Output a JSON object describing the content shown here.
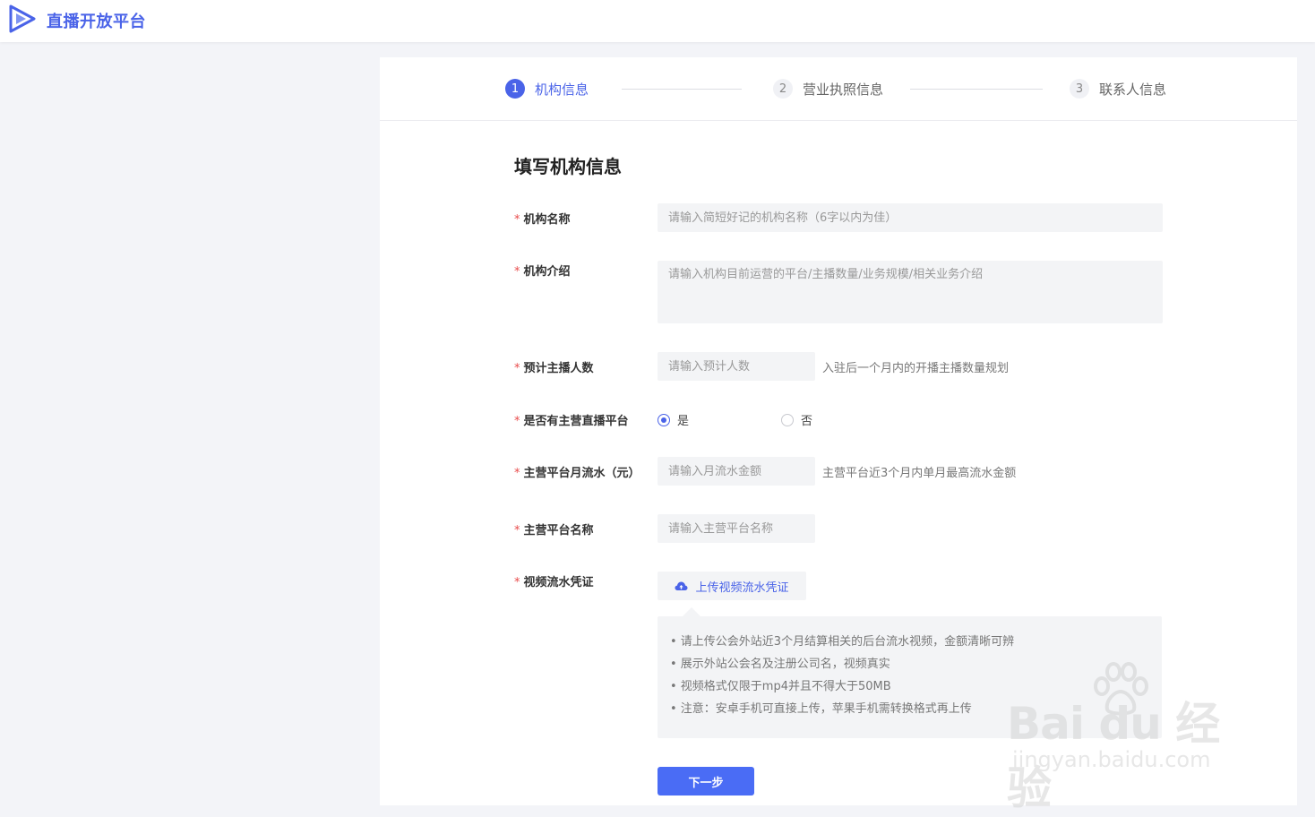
{
  "app": {
    "title": "直播开放平台"
  },
  "steps": [
    {
      "num": "1",
      "label": "机构信息",
      "active": true
    },
    {
      "num": "2",
      "label": "营业执照信息",
      "active": false
    },
    {
      "num": "3",
      "label": "联系人信息",
      "active": false
    }
  ],
  "form": {
    "title": "填写机构信息",
    "required_mark": "*",
    "org_name": {
      "label": "机构名称",
      "placeholder": "请输入简短好记的机构名称（6字以内为佳）",
      "value": ""
    },
    "org_intro": {
      "label": "机构介绍",
      "placeholder": "请输入机构目前运营的平台/主播数量/业务规模/相关业务介绍",
      "value": ""
    },
    "anchor_count": {
      "label": "预计主播人数",
      "placeholder": "请输入预计人数",
      "hint": "入驻后一个月内的开播主播数量规划",
      "value": ""
    },
    "has_platform": {
      "label": "是否有主营直播平台",
      "options": [
        "是",
        "否"
      ],
      "selected": "是"
    },
    "monthly_flow": {
      "label": "主营平台月流水（元）",
      "placeholder": "请输入月流水金额",
      "hint": "主营平台近3个月内单月最高流水金额",
      "value": ""
    },
    "platform_name": {
      "label": "主营平台名称",
      "placeholder": "请输入主营平台名称",
      "value": ""
    },
    "video_proof": {
      "label": "视频流水凭证",
      "upload_label": "上传视频流水凭证",
      "tips": [
        "• 请上传公会外站近3个月结算相关的后台流水视频，金额清晰可辨",
        "• 展示外站公会名及注册公司名，视频真实",
        "• 视频格式仅限于mp4并且不得大于50MB",
        "• 注意：安卓手机可直接上传，苹果手机需转换格式再上传"
      ]
    },
    "next_label": "下一步"
  },
  "watermark": {
    "main": "Bai du 经验",
    "sub": "jingyan.baidu.com"
  },
  "colors": {
    "accent": "#4a63e8",
    "required": "#e84a4a",
    "field_bg": "#f3f4f6"
  }
}
